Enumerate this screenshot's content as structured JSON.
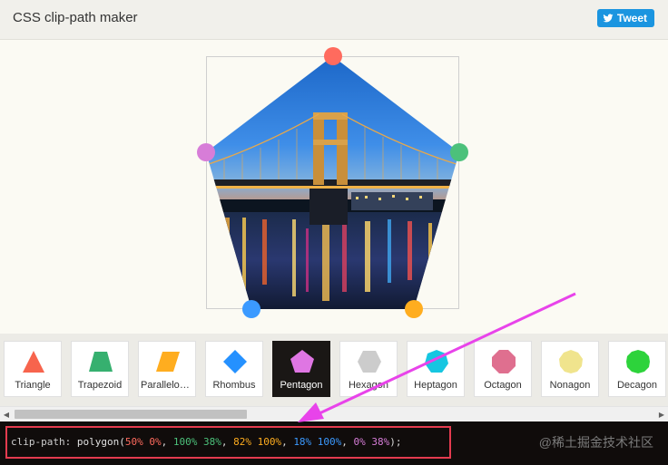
{
  "header": {
    "title": "CSS clip-path maker",
    "tweet_label": "Tweet"
  },
  "editor": {
    "image": "river-bridge-night-photo",
    "handles": [
      {
        "name": "top",
        "color": "#ff6b5e"
      },
      {
        "name": "right",
        "color": "#4cc17b"
      },
      {
        "name": "bottom-right",
        "color": "#ffad1f"
      },
      {
        "name": "bottom-left",
        "color": "#3b9aff"
      },
      {
        "name": "left",
        "color": "#d77dd8"
      }
    ]
  },
  "shapes": [
    {
      "label": "Triangle",
      "icon": "triangle-icon",
      "color": "#f7644d",
      "active": false
    },
    {
      "label": "Trapezoid",
      "icon": "trapezoid-icon",
      "color": "#36b06f",
      "active": false
    },
    {
      "label": "Parallelogram",
      "icon": "parallelogram-icon",
      "color": "#ffad1f",
      "active": false
    },
    {
      "label": "Rhombus",
      "icon": "rhombus-icon",
      "color": "#2591ff",
      "active": false
    },
    {
      "label": "Pentagon",
      "icon": "pentagon-icon",
      "color": "#df76e3",
      "active": true
    },
    {
      "label": "Hexagon",
      "icon": "hexagon-icon",
      "color": "#cccccc",
      "active": false
    },
    {
      "label": "Heptagon",
      "icon": "heptagon-icon",
      "color": "#16c6e1",
      "active": false
    },
    {
      "label": "Octagon",
      "icon": "octagon-icon",
      "color": "#df6f8f",
      "active": false
    },
    {
      "label": "Nonagon",
      "icon": "nonagon-icon",
      "color": "#f0e48d",
      "active": false
    },
    {
      "label": "Decagon",
      "icon": "decagon-icon",
      "color": "#2dd33b",
      "active": false
    }
  ],
  "code": {
    "property": "clip-path:",
    "func_open": "polygon(",
    "points": [
      {
        "text": "50% 0%",
        "color": "#ff6b5e"
      },
      {
        "text": "100% 38%",
        "color": "#4cc17b"
      },
      {
        "text": "82% 100%",
        "color": "#ffad1f"
      },
      {
        "text": "18% 100%",
        "color": "#3b9aff"
      },
      {
        "text": "0% 38%",
        "color": "#d77dd8"
      }
    ],
    "sep": ", ",
    "func_close": ");",
    "watermark": "@稀土掘金技术社区"
  },
  "colors": {
    "code_highlight": "#e43b4f",
    "annotation_arrow": "#e843ea",
    "header_bg": "#f1f0eb",
    "code_bg": "#100c0b"
  }
}
